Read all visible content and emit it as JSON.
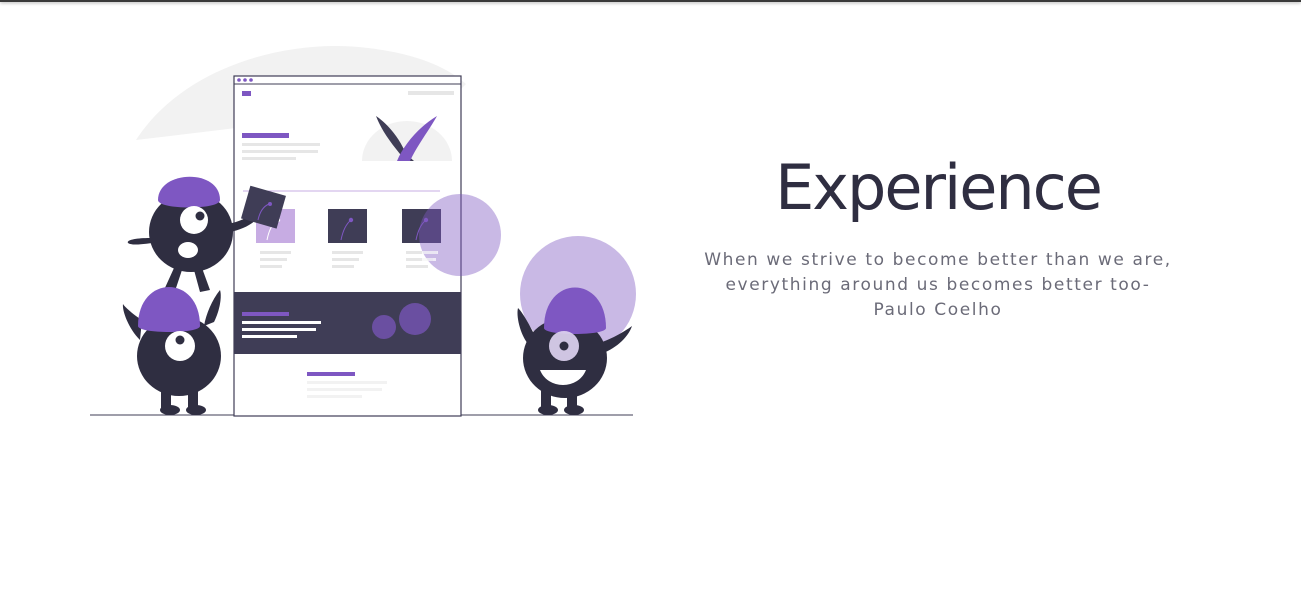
{
  "hero": {
    "title": "Experience",
    "quote_lines": [
      "When we strive to become better than we are,",
      "everything around us becomes better too-",
      "Paulo Coelho"
    ]
  },
  "illustration": {
    "icon": "monsters-building-website-illustration"
  },
  "colors": {
    "accent": "#7e57c2",
    "accent_light": "#c7ace3",
    "dark": "#3f3d56",
    "monster_body": "#2f2e41",
    "blob_gray": "#f2f2f2",
    "text_heading": "#2f2e41",
    "text_body": "#6b6b78"
  }
}
